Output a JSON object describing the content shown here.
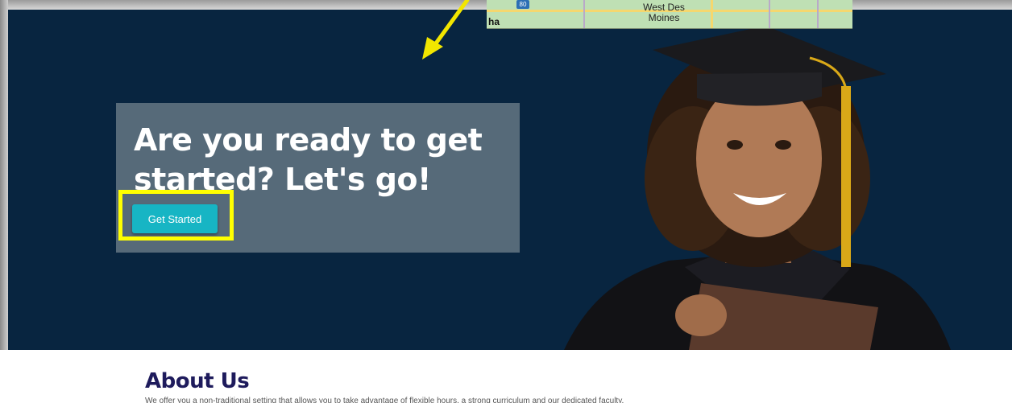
{
  "hero": {
    "title": "Are you ready to get started? Let's go!",
    "cta_label": "Get Started"
  },
  "map": {
    "city_label": "West Des Moines",
    "city_line1": "West Des",
    "city_line2": "Moines",
    "partial_label": "ha",
    "highway_shield": "80"
  },
  "about": {
    "title": "About Us",
    "text": "We offer you a non-traditional setting that allows you to take advantage of flexible hours, a strong curriculum and our dedicated faculty."
  },
  "colors": {
    "hero_bg": "#082540",
    "card_bg": "#566a79",
    "cta_bg": "#17b5c4",
    "highlight": "#ffff00",
    "about_title": "#1e1b5c"
  },
  "icons": {
    "annotation_arrow": "arrow-icon",
    "graduate_photo": "graduate-image"
  }
}
